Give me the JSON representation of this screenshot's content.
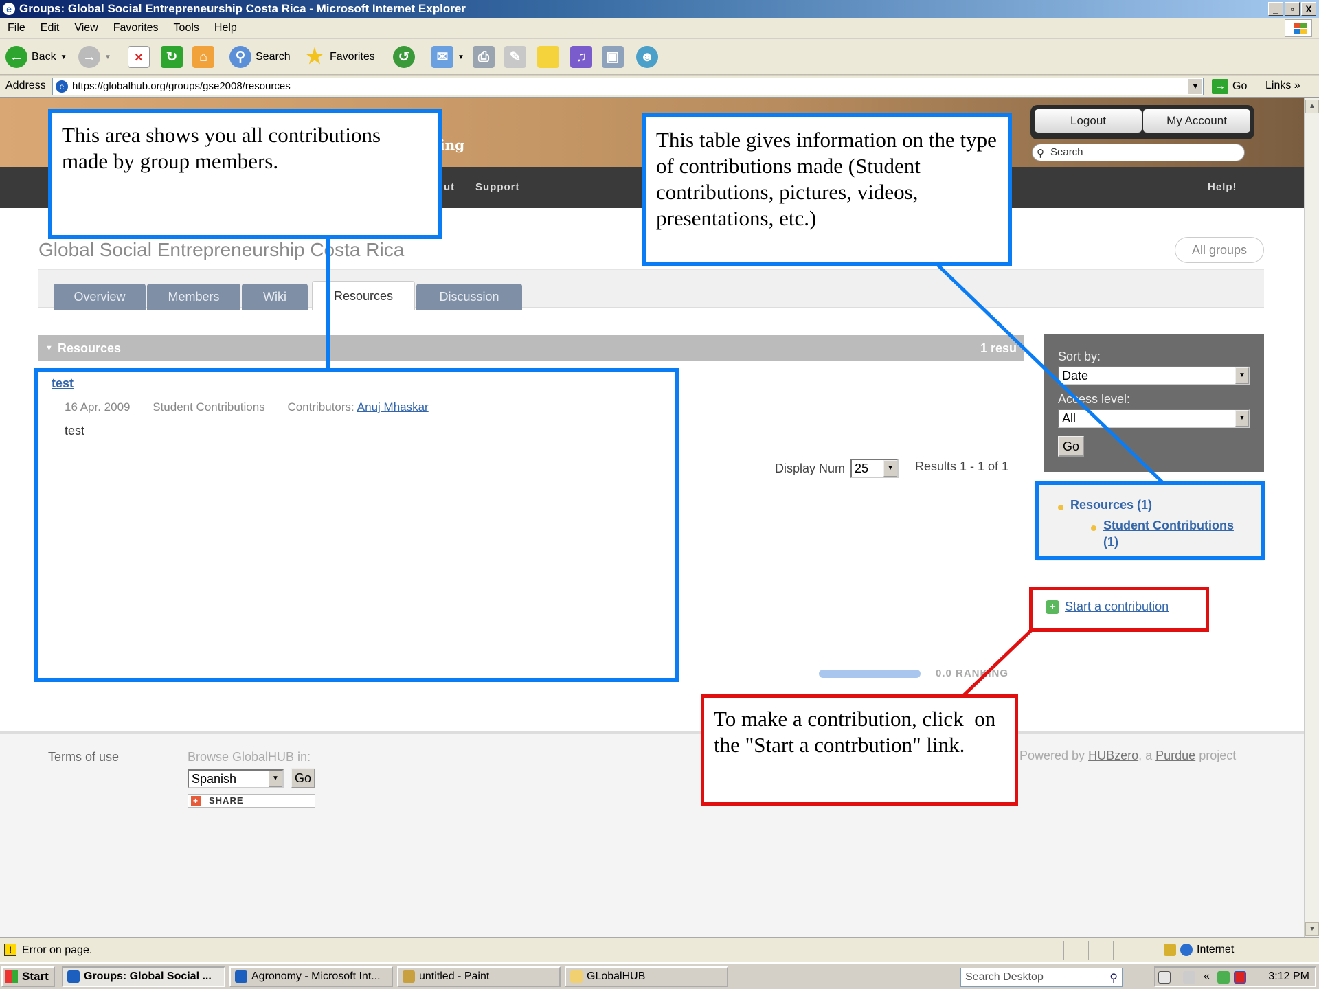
{
  "window": {
    "title": "Groups: Global Social Entrepreneurship Costa Rica - Microsoft Internet Explorer",
    "controls": [
      "_",
      "▫",
      "X"
    ]
  },
  "menu": [
    "File",
    "Edit",
    "View",
    "Favorites",
    "Tools",
    "Help"
  ],
  "toolbar": {
    "back": "Back",
    "search": "Search",
    "favorites": "Favorites"
  },
  "address": {
    "label": "Address",
    "url": "https://globalhub.org/groups/gse2008/resources",
    "go": "Go",
    "links": "Links"
  },
  "site": {
    "tagline_fragment": "ing",
    "logout": "Logout",
    "my_account": "My Account",
    "search_placeholder": "Search",
    "nav": {
      "partial": "ut",
      "support": "Support",
      "help": "Help!"
    }
  },
  "group": {
    "title": "Global Social Entrepreneurship Costa Rica",
    "all_groups": "All groups",
    "tabs": [
      {
        "label": "Overview",
        "active": false
      },
      {
        "label": "Members",
        "active": false
      },
      {
        "label": "Wiki",
        "active": false
      },
      {
        "label": "Resources",
        "active": true
      },
      {
        "label": "Discussion",
        "active": false
      }
    ]
  },
  "resources": {
    "header": "Resources",
    "count_label": "1 resu",
    "items": [
      {
        "title": "test",
        "date": "16 Apr. 2009",
        "type": "Student Contributions",
        "contributors_label": "Contributors:",
        "contributor": "Anuj Mhaskar",
        "description": "test"
      }
    ],
    "display_num_label": "Display Num",
    "display_num_value": "25",
    "results_text": "Results 1 - 1 of 1",
    "ranking_value": 0.0,
    "ranking_label": "0.0 RANKING"
  },
  "sidebar": {
    "sort_label": "Sort by:",
    "sort_value": "Date",
    "access_label": "Access level:",
    "access_value": "All",
    "go": "Go",
    "categories": [
      {
        "label": "Resources (1)"
      },
      {
        "label": "Student Contributions",
        "count": "(1)"
      }
    ],
    "start_contribution": "Start a contribution"
  },
  "footer": {
    "terms": "Terms of use",
    "browse_label": "Browse GlobalHUB in:",
    "language": "Spanish",
    "go": "Go",
    "share": "SHARE",
    "powered_prefix": "Powered by",
    "hubzero": "HUBzero",
    "powered_mid": ", a",
    "purdue": "Purdue",
    "powered_suffix": "project"
  },
  "callouts": {
    "contributions_area": "This area shows you all contributions made by group members.",
    "table_info": "This table gives information on the type of contributions made (Student contributions, pictures, videos, presentations, etc.)",
    "make_contribution": "To make a contribution, click  on the \"Start a contrbution\" link.",
    "blue_color": "#0a7cf4",
    "red_color": "#e01010"
  },
  "status": {
    "message": "Error on page.",
    "zone": "Internet"
  },
  "taskbar": {
    "start": "Start",
    "tasks": [
      {
        "label": "Groups: Global Social ...",
        "active": true
      },
      {
        "label": "Agronomy - Microsoft Int...",
        "active": false
      },
      {
        "label": "untitled - Paint",
        "active": false
      },
      {
        "label": "GLobalHUB",
        "active": false
      }
    ],
    "search_placeholder": "Search Desktop",
    "chevron": "«",
    "clock": "3:12 PM"
  }
}
